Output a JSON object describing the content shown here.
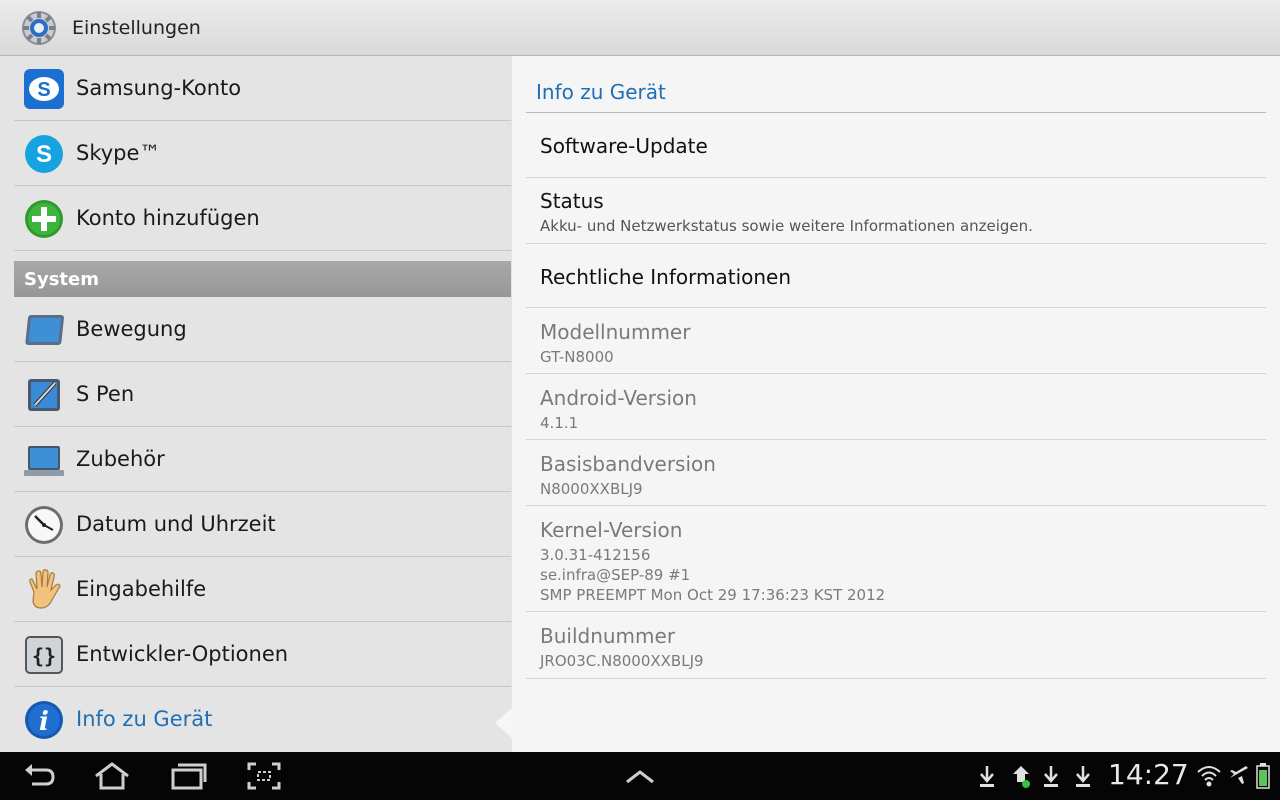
{
  "titlebar": {
    "title": "Einstellungen",
    "icon": "settings-gear-icon"
  },
  "accounts": [
    {
      "label": "Samsung-Konto",
      "icon": "samsung-account-icon"
    },
    {
      "label": "Skype™",
      "icon": "skype-icon"
    },
    {
      "label": "Konto hinzufügen",
      "icon": "add-account-icon"
    }
  ],
  "system_section": {
    "label": "System"
  },
  "system_items": [
    {
      "label": "Bewegung",
      "icon": "motion-icon"
    },
    {
      "label": "S Pen",
      "icon": "s-pen-icon"
    },
    {
      "label": "Zubehör",
      "icon": "accessory-icon"
    },
    {
      "label": "Datum und Uhrzeit",
      "icon": "clock-icon"
    },
    {
      "label": "Eingabehilfe",
      "icon": "hand-icon"
    },
    {
      "label": "Entwickler-Optionen",
      "icon": "braces-icon"
    },
    {
      "label": "Info zu Gerät",
      "icon": "info-icon",
      "selected": true
    }
  ],
  "detail": {
    "header": "Info zu Gerät",
    "items": [
      {
        "title": "Software-Update",
        "summary": ""
      },
      {
        "title": "Status",
        "summary": "Akku- und Netzwerkstatus sowie weitere Informationen anzeigen."
      },
      {
        "title": "Rechtliche Informationen",
        "summary": ""
      },
      {
        "title": "Modellnummer",
        "summary": "GT-N8000"
      },
      {
        "title": "Android-Version",
        "summary": "4.1.1"
      },
      {
        "title": "Basisbandversion",
        "summary": "N8000XXBLJ9"
      },
      {
        "title": "Kernel-Version",
        "summary_lines": [
          "3.0.31-412156",
          "se.infra@SEP-89 #1",
          "SMP PREEMPT Mon Oct 29 17:36:23 KST 2012"
        ]
      },
      {
        "title": "Buildnummer",
        "summary": "JRO03C.N8000XXBLJ9"
      }
    ]
  },
  "navbar": {
    "buttons": [
      "back-icon",
      "home-icon",
      "recent-apps-icon",
      "screenshot-icon",
      "expand-up-icon"
    ],
    "clock": "14:27",
    "status_icons": [
      "download-icon",
      "sync-icon",
      "download-icon",
      "download-icon",
      "wifi-icon",
      "airplane-icon",
      "battery-icon"
    ]
  },
  "colors": {
    "accent": "#1f6fb5",
    "section_header": "#9e9e9e",
    "navbar": "#050505"
  }
}
